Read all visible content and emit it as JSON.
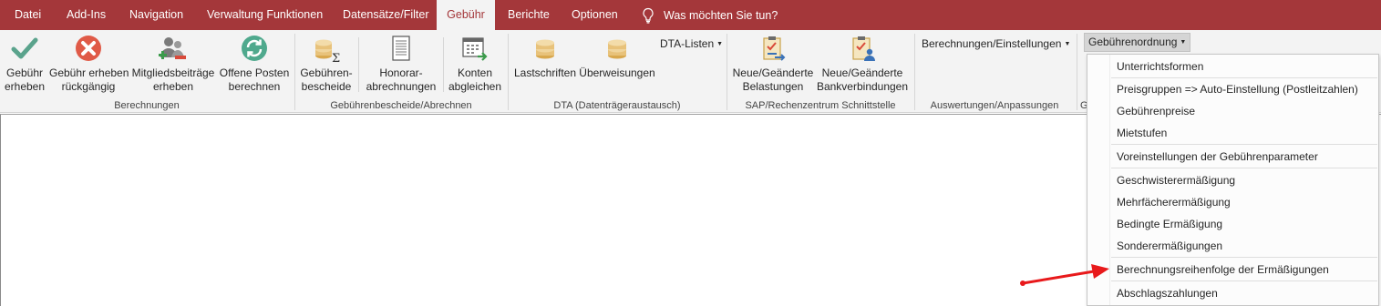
{
  "tabs": {
    "datei": "Datei",
    "addins": "Add-Ins",
    "navigation": "Navigation",
    "verwaltung": "Verwaltung Funktionen",
    "datensaetze": "Datensätze/Filter",
    "gebuehr": "Gebühr",
    "berichte": "Berichte",
    "optionen": "Optionen",
    "tell_me": "Was möchten Sie tun?"
  },
  "ribbon": {
    "berechnungen": {
      "label": "Berechnungen",
      "gebuehr_erheben": [
        "Gebühr",
        "erheben"
      ],
      "gebuehr_rueck": [
        "Gebühr erheben",
        "rückgängig"
      ],
      "mitglied": [
        "Mitgliedsbeiträge",
        "erheben"
      ],
      "offene": [
        "Offene Posten",
        "berechnen"
      ]
    },
    "bescheide": {
      "label": "Gebührenbescheide/Abrechnen",
      "gebuehren_bescheide": [
        "Gebühren-",
        "bescheide"
      ],
      "honorar": [
        "Honorar-",
        "abrechnungen"
      ],
      "konten": [
        "Konten",
        "abgleichen"
      ]
    },
    "dta": {
      "label": "DTA (Datenträgeraustausch)",
      "lastschriften": "Lastschriften",
      "ueberweisungen": "Überweisungen",
      "dta_listen": "DTA-Listen"
    },
    "sap": {
      "label": "SAP/Rechenzentrum Schnittstelle",
      "belastungen": [
        "Neue/Geänderte",
        "Belastungen"
      ],
      "bankverbindungen": [
        "Neue/Geänderte",
        "Bankverbindungen"
      ]
    },
    "auswertungen": {
      "label": "Auswertungen/Anpassungen",
      "berechnungen_einstellungen": "Berechnungen/Einstellungen"
    },
    "gebuehrenordnung": {
      "label_partial": "G",
      "button": "Gebührenordnung"
    }
  },
  "menu": {
    "items": [
      "Unterrichtsformen",
      "Preisgruppen => Auto-Einstellung (Postleitzahlen)",
      "Gebührenpreise",
      "Mietstufen",
      "Voreinstellungen der Gebührenparameter",
      "Geschwisterermäßigung",
      "Mehrfächerermäßigung",
      "Bedingte Ermäßigung",
      "Sonderermäßigungen",
      "Berechnungsreihenfolge der Ermäßigungen",
      "Abschlagszahlungen"
    ]
  },
  "colors": {
    "accent": "#a4373a",
    "ribbon_bg": "#f3f3f3",
    "annotation_arrow": "#e8191b"
  }
}
